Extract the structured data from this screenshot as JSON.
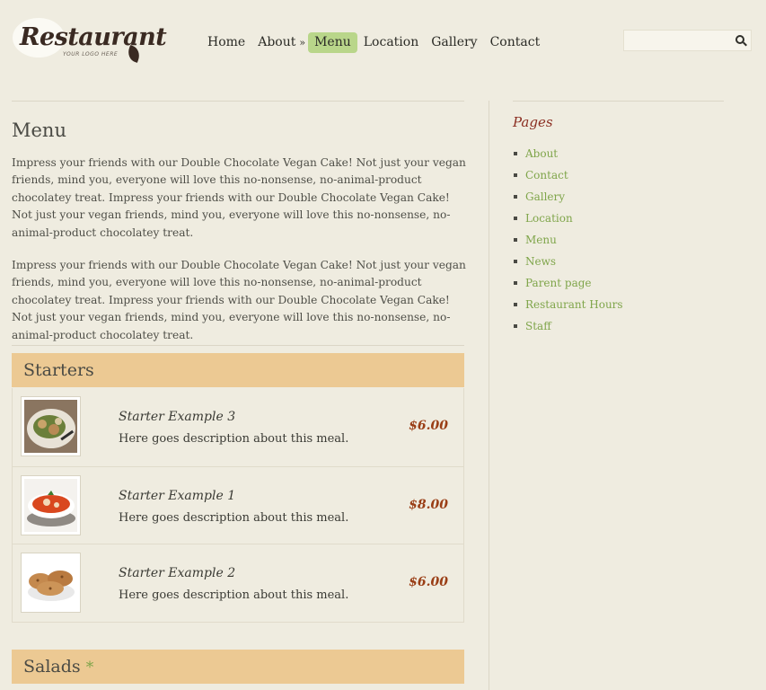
{
  "header": {
    "logo_text": "Restaurant",
    "logo_sub": "YOUR LOGO HERE",
    "nav": [
      {
        "label": "Home",
        "active": false
      },
      {
        "label": "About",
        "active": false,
        "arrow": "»"
      },
      {
        "label": "Menu",
        "active": true
      },
      {
        "label": "Location",
        "active": false
      },
      {
        "label": "Gallery",
        "active": false
      },
      {
        "label": "Contact",
        "active": false
      }
    ],
    "search_placeholder": ""
  },
  "main": {
    "title": "Menu",
    "intro_paragraphs": [
      "Impress your friends with our Double Chocolate Vegan Cake!  Not just your vegan friends, mind you, everyone will love this no-nonsense, no-animal-product chocolatey treat. Impress your friends with our Double Chocolate Vegan Cake!  Not just your vegan friends, mind you, everyone will love this no-nonsense, no-animal-product chocolatey treat.",
      "Impress your friends with our Double Chocolate Vegan Cake!  Not just your vegan friends, mind you, everyone will love this no-nonsense, no-animal-product chocolatey treat. Impress your friends with our Double Chocolate Vegan Cake!  Not just your vegan friends, mind you, everyone will love this no-nonsense, no-animal-product chocolatey treat."
    ],
    "sections": [
      {
        "title": "Starters",
        "items": [
          {
            "name": "Starter Example 3",
            "desc": "Here goes description about this meal.",
            "price": "$6.00",
            "thumb": "salad-plate"
          },
          {
            "name": "Starter Example 1",
            "desc": "Here goes description about this meal.",
            "price": "$8.00",
            "thumb": "soup-bowl"
          },
          {
            "name": "Starter Example 2",
            "desc": "Here goes description about this meal.",
            "price": "$6.00",
            "thumb": "cookies-plate"
          }
        ]
      },
      {
        "title": "Salads",
        "marker": "*"
      }
    ]
  },
  "sidebar": {
    "title": "Pages",
    "items": [
      "About",
      "Contact",
      "Gallery",
      "Location",
      "Menu",
      "News",
      "Parent page",
      "Restaurant Hours",
      "Staff"
    ]
  },
  "colors": {
    "background": "#efece0",
    "nav_active": "#b9d68a",
    "section_header": "#ecc993",
    "price": "#9a3e16",
    "sidebar_title": "#8b2e22",
    "sidebar_link": "#7fa54a"
  }
}
